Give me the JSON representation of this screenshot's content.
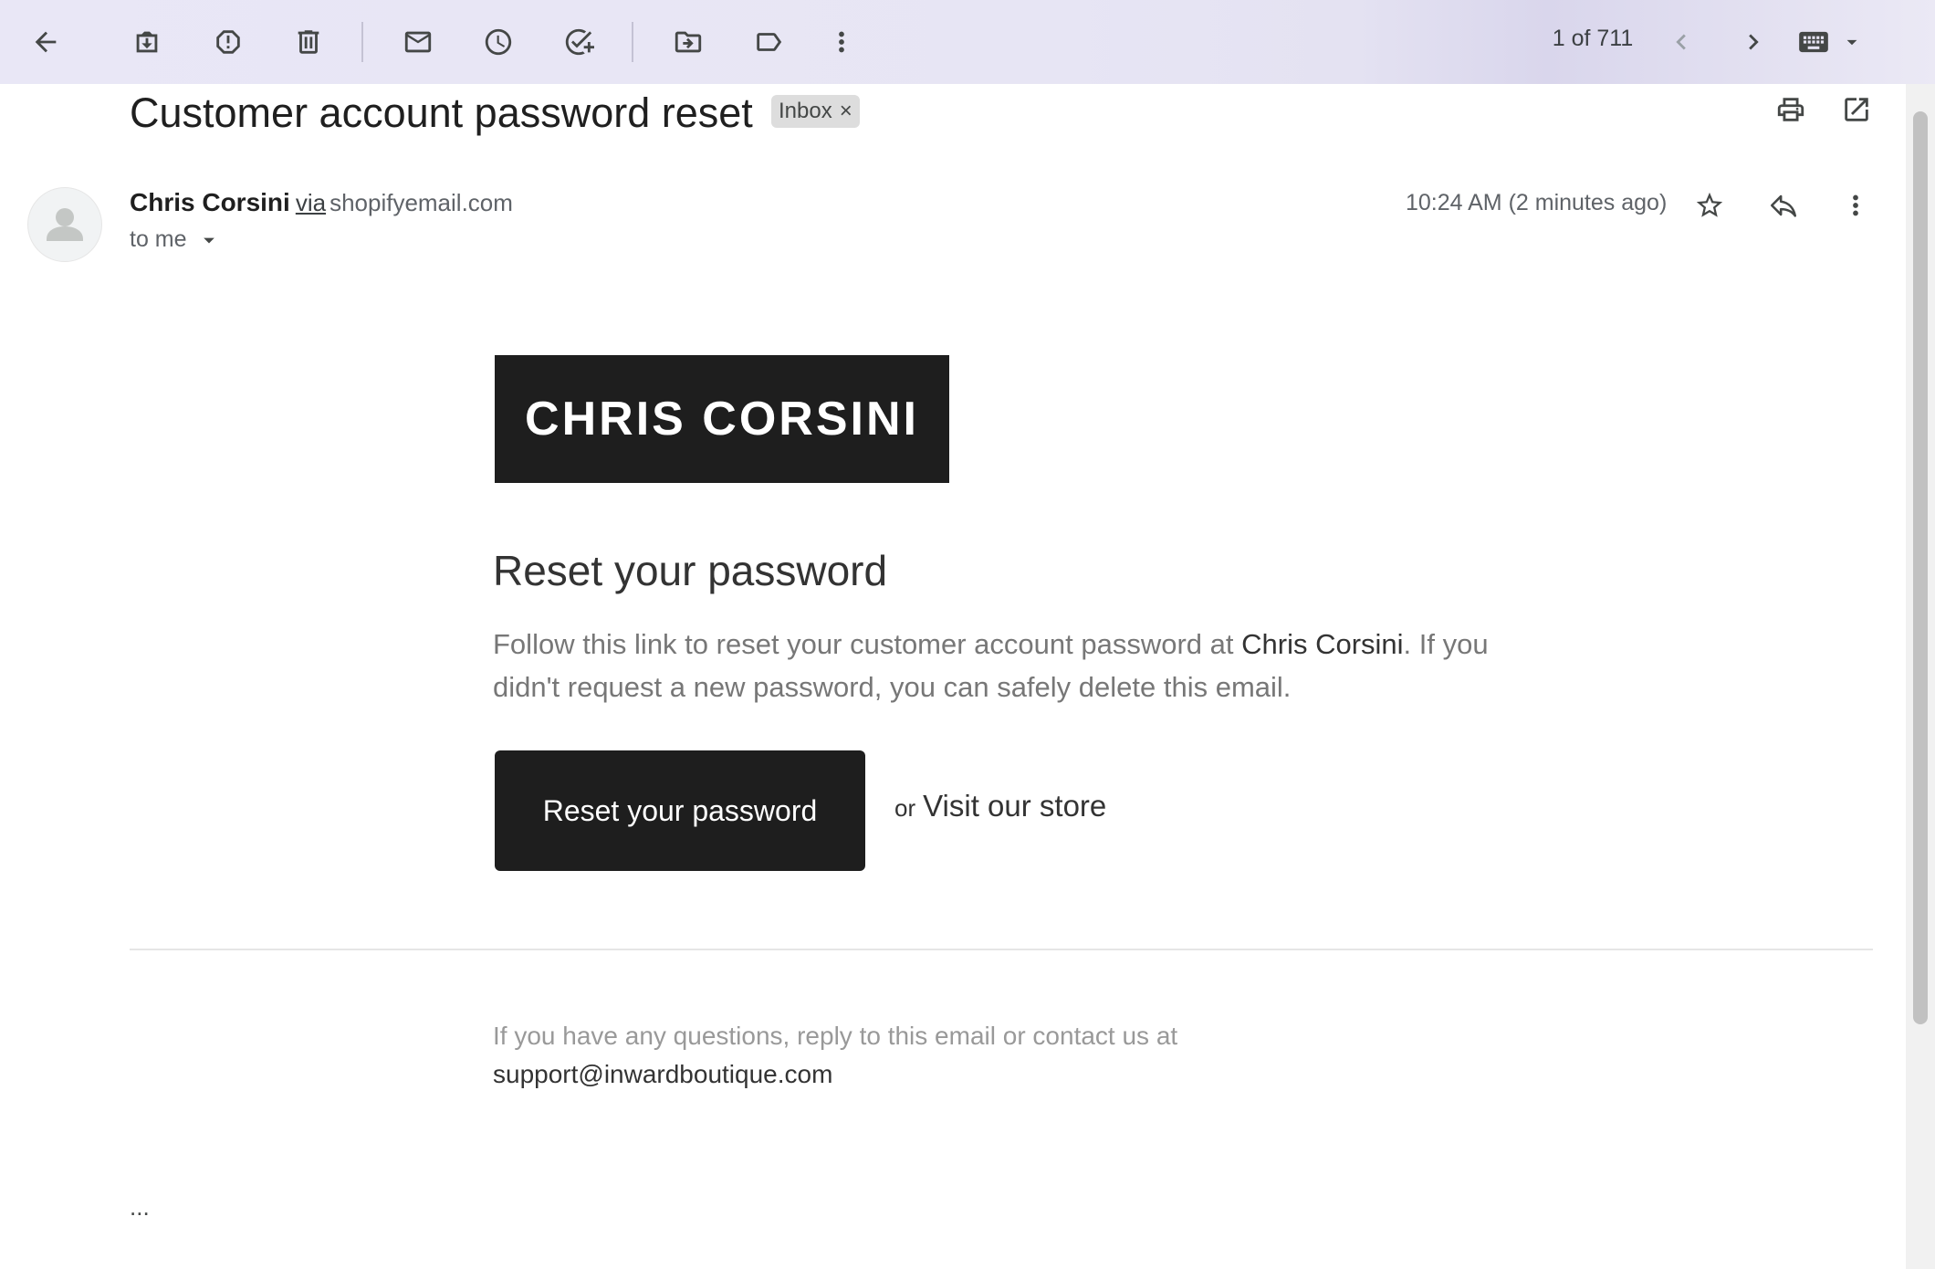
{
  "toolbar": {
    "icons": {
      "back": "arrow-left-icon",
      "archive": "archive-icon",
      "spam": "report-spam-icon",
      "delete": "trash-icon",
      "unread": "mail-icon",
      "snooze": "clock-icon",
      "task": "add-task-icon",
      "move": "move-to-icon",
      "label": "label-icon",
      "more": "more-vertical-icon"
    },
    "pager": "1 of 711",
    "input_tools": "keyboard-icon"
  },
  "email": {
    "subject": "Customer account password reset",
    "label": "Inbox",
    "label_close": "×",
    "sender_name": "Chris Corsini",
    "via": "via",
    "sender_domain": "shopifyemail.com",
    "recipient": "to me",
    "timestamp": "10:24 AM (2 minutes ago)"
  },
  "body": {
    "logo_text": "CHRIS CORSINI",
    "heading": "Reset your password",
    "paragraph_before": "Follow this link to reset your customer account password at ",
    "store_name": "Chris Corsini",
    "paragraph_after": ". If you didn't request a new password, you can safely delete this email.",
    "reset_button": "Reset your password",
    "or_text": "or",
    "visit_link": "Visit our store",
    "footer_text": "If you have any questions, reply to this email or contact us at",
    "support_email": "support@inwardboutique.com",
    "trimmed": "..."
  },
  "colors": {
    "accent_dark": "#1e1e1e",
    "toolbar_bg": "#e9e7f6",
    "wallpaper": "#3d3e9a"
  }
}
